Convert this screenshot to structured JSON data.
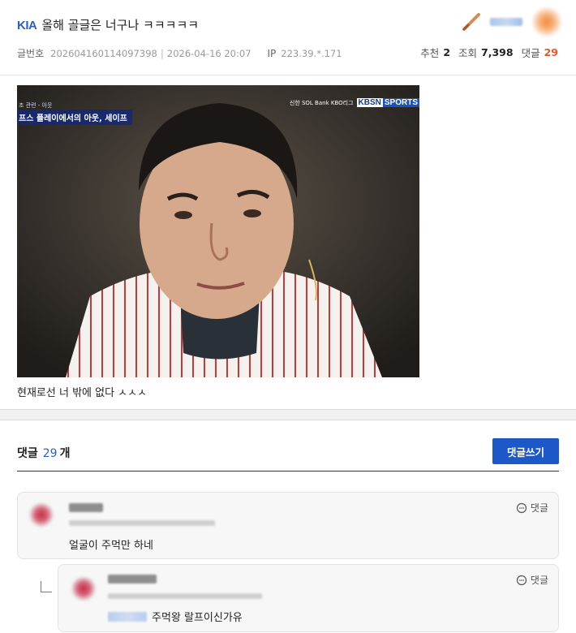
{
  "post": {
    "team": "KIA",
    "title": "올해 골글은 너구나 ㅋㅋㅋㅋㅋ",
    "no_label": "글번호",
    "no_value": "202604160114097398",
    "date": "2026-04-16 20:07",
    "ip_label": "IP",
    "ip_value": "223.39.*.171",
    "recommend_label": "추천",
    "recommend_value": "2",
    "views_label": "조회",
    "views_value": "7,398",
    "comments_label": "댓글",
    "comments_value": "29",
    "body_text": "현재로선 너 밖에 없다 ㅅㅅㅅ"
  },
  "image": {
    "caption_top": "초 관련 - 아웃",
    "caption_main": "프스 플레이에서의 아웃, 세이프",
    "broadcast_small": "신한 SOL Bank KBO리그",
    "broadcast_kbsn": "KBSN",
    "broadcast_sports": "SPORTS"
  },
  "comments": {
    "header_label": "댓글",
    "header_count": "29",
    "header_unit": "개",
    "write_button": "댓글쓰기",
    "reply_label": "댓글",
    "items": [
      {
        "text": "얼굴이 주먹만 하네"
      },
      {
        "text": "주먹왕 랄프이신가유"
      }
    ]
  }
}
